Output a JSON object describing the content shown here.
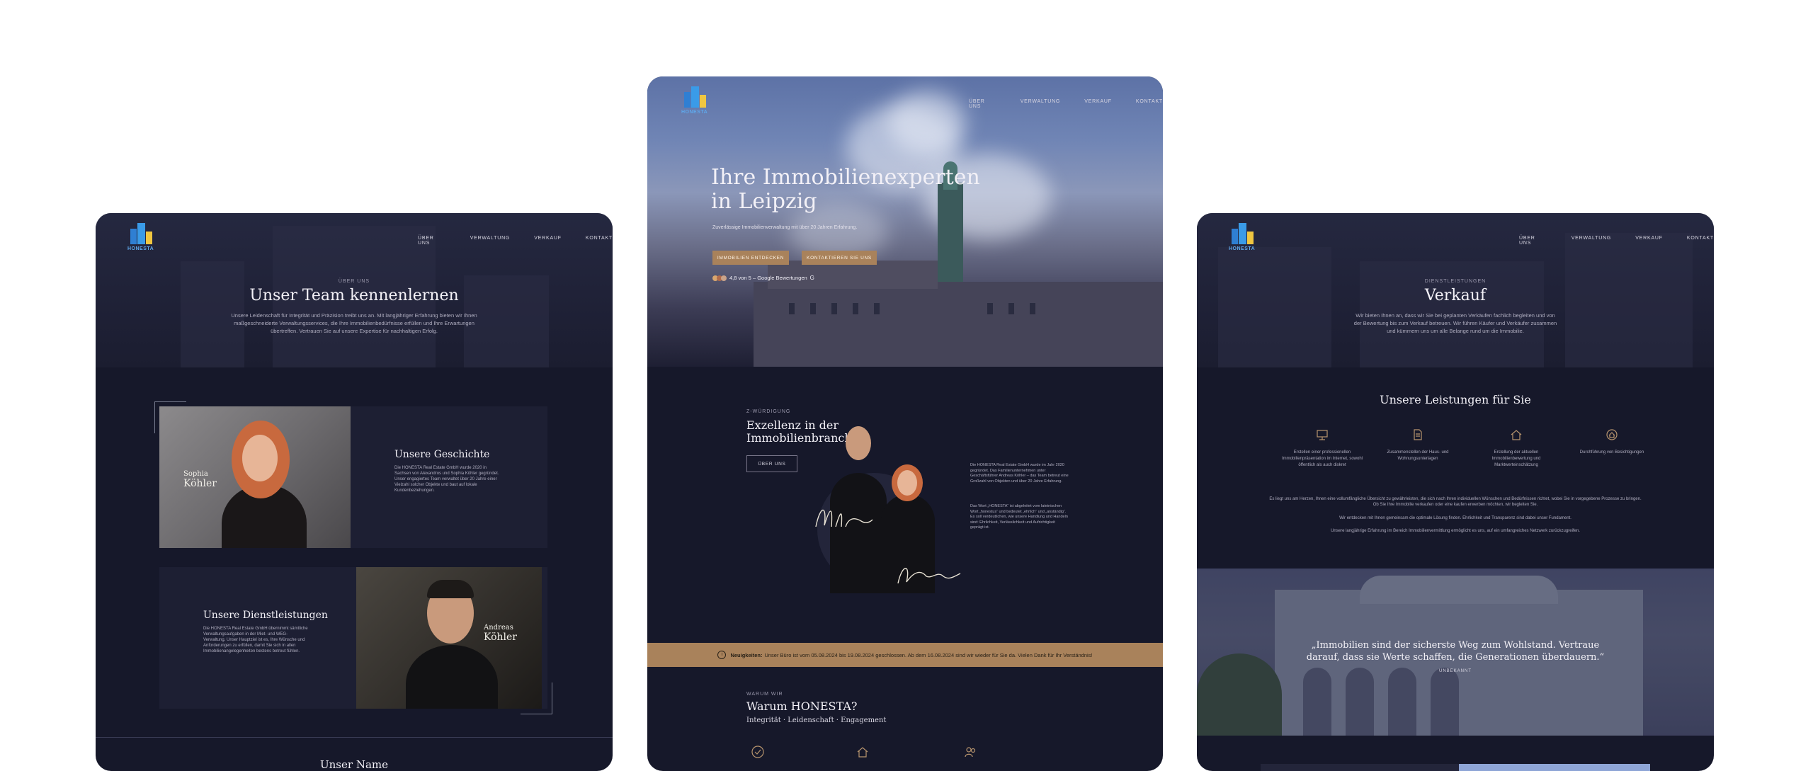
{
  "nav": {
    "logo_text": "HONESTA",
    "items": [
      "ÜBER UNS",
      "VERWALTUNG",
      "VERKAUF",
      "KONTAKT"
    ]
  },
  "left": {
    "eyebrow": "ÜBER UNS",
    "title": "Unser Team kennenlernen",
    "intro": "Unsere Leidenschaft für Integrität und Präzision treibt uns an. Mit langjähriger Erfahrung bieten wir Ihnen maßgeschneiderte Verwaltungsservices, die Ihre Immobilienbedürfnisse erfüllen und Ihre Erwartungen übertreffen. Vertrauen Sie auf unsere Expertise für nachhaltigen Erfolg.",
    "person1_first": "Sophia",
    "person1_last": "Köhler",
    "story_title": "Unsere Geschichte",
    "story_text": "Die HONESTA Real Estate GmbH wurde 2020 in Sachsen von Alexandros und Sophia Köhler gegründet. Unser engagiertes Team verwaltet über 20 Jahre einer Vielzahl solcher Objekte und baut auf lokale Kundenbeziehungen.",
    "services_title": "Unsere Dienstleistungen",
    "services_text": "Die HONESTA Real Estate GmbH übernimmt sämtliche Verwaltungsaufgaben in der Miet- und WEG-Verwaltung. Unser Hauptziel ist es, Ihre Wünsche und Anforderungen zu erfüllen, damit Sie sich in allen Immobilienangelegenheiten bestens betreut fühlen.",
    "person2_first": "Andreas",
    "person2_last": "Köhler",
    "next_title": "Unser Name"
  },
  "mid": {
    "hero_title_1": "Ihre Immobilienexperten",
    "hero_title_2": "in Leipzig",
    "hero_sub": "Zuverlässige Immobilienverwaltung mit über 20 Jahren Erfahrung.",
    "btn_primary": "IMMOBILIEN ENTDECKEN",
    "btn_secondary": "KONTAKTIEREN SIE UNS",
    "rating": "4,8 von 5 – Google Bewertungen",
    "about_eyebrow": "Z-WÜRDIGUNG",
    "about_title_1": "Exzellenz in der",
    "about_title_2": "Immobilienbranche",
    "about_btn": "ÜBER UNS",
    "about_text_1": "Die HONESTA Real Estate GmbH wurde im Jahr 2020 gegründet. Das Familienunternehmen unter Geschäftsführer Andreas Köhler – das Team betreut eine Großzahl von Objekten und über 20 Jahre Erfahrung.",
    "about_text_2": "Das Wort „HONESTA“ ist abgeleitet vom lateinischen Wort „honestus“ und bedeutet „ehrlich“ und „anständig“. Es soll verdeutlichen, wie unsere Handlung und Handeln sind: Ehrlichkeit, Verlässlichkeit und Aufrichtigkeit geprägt ist.",
    "news_label": "Neuigkeiten:",
    "news_text": "Unser Büro ist vom 05.08.2024 bis 19.08.2024 geschlossen. Ab dem 16.08.2024 sind wir wieder für Sie da. Vielen Dank für Ihr Verständnis!",
    "why_eyebrow": "WARUM WIR",
    "why_title": "Warum HONESTA?",
    "why_sub": "Integrität · Leidenschaft · Engagement"
  },
  "right": {
    "eyebrow": "DIENSTLEISTUNGEN",
    "title": "Verkauf",
    "intro": "Wir bieten Ihnen an, dass wir Sie bei geplanten Verkäufen fachlich begleiten und von der Bewertung bis zum Verkauf betreuen. Wir führen Käufer und Verkäufer zusammen und kümmern uns um alle Belange rund um die Immobilie.",
    "services_title": "Unsere Leistungen für Sie",
    "services": [
      "Erstellen einer professionellen Immobilienpräsentation im Internet, sowohl öffentlich als auch diskret",
      "Zusammenstellen der Haus- und Wohnungsunterlagen",
      "Erstellung der aktuellen Immobilienbewertung und Marktwerteinschätzung",
      "Durchführung von Besichtigungen"
    ],
    "body_1": "Es liegt uns am Herzen, Ihnen eine vollumfängliche Übersicht zu gewährleisten, die sich nach Ihren individuellen Wünschen und Bedürfnissen richtet, wobei Sie in vorgegebene Prozesse zu bringen. Ob Sie Ihre Immobilie verkaufen oder eine kaufen erwerben möchten, wir begleiten Sie.",
    "body_2": "Wir entdecken mit Ihnen gemeinsam die optimale Lösung finden. Ehrlichkeit und Transparenz sind dabei unser Fundament.",
    "body_3": "Unsere langjährige Erfahrung im Bereich Immobilienvermittlung ermöglicht es uns, auf ein umfangreiches Netzwerk zurückzugreifen.",
    "quote_1": "„Immobilien sind der sicherste Weg zum Wohlstand. Vertraue",
    "quote_2": "darauf, dass sie Werte schaffen, die Generationen überdauern.“",
    "quote_author": "UNBEKANNT"
  }
}
